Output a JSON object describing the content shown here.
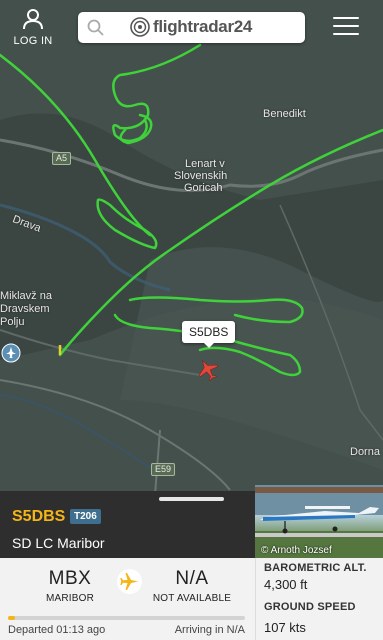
{
  "map": {
    "places": [
      "Benedikt",
      "Lenart v",
      "Slovenskih",
      "Goricah",
      "Drava",
      "Miklavž na",
      "Dravskem",
      "Polju",
      "Dorna"
    ],
    "roads": [
      "A5",
      "E59"
    ],
    "callsign_tag": "S5DBS"
  },
  "header": {
    "login_label": "LOG IN",
    "logo_text": "flightradar24"
  },
  "flight": {
    "callsign": "S5DBS",
    "aircraft_type": "T206",
    "operator": "SD LC Maribor",
    "photo_credit": "© Arnoth Jozsef",
    "origin_code": "MBX",
    "origin_name": "MARIBOR",
    "destination_code": "N/A",
    "destination_name": "NOT AVAILABLE",
    "progress": 0.03,
    "departed": "Departed 01:13 ago",
    "arriving": "Arriving in N/A",
    "altitude_label": "BAROMETRIC ALT.",
    "altitude_value": "4,300 ft",
    "speed_label": "GROUND SPEED",
    "speed_value": "107 kts"
  },
  "colors": {
    "track": "#3fd23a",
    "accent": "#f5b517",
    "aircraft": "#e2473a"
  }
}
